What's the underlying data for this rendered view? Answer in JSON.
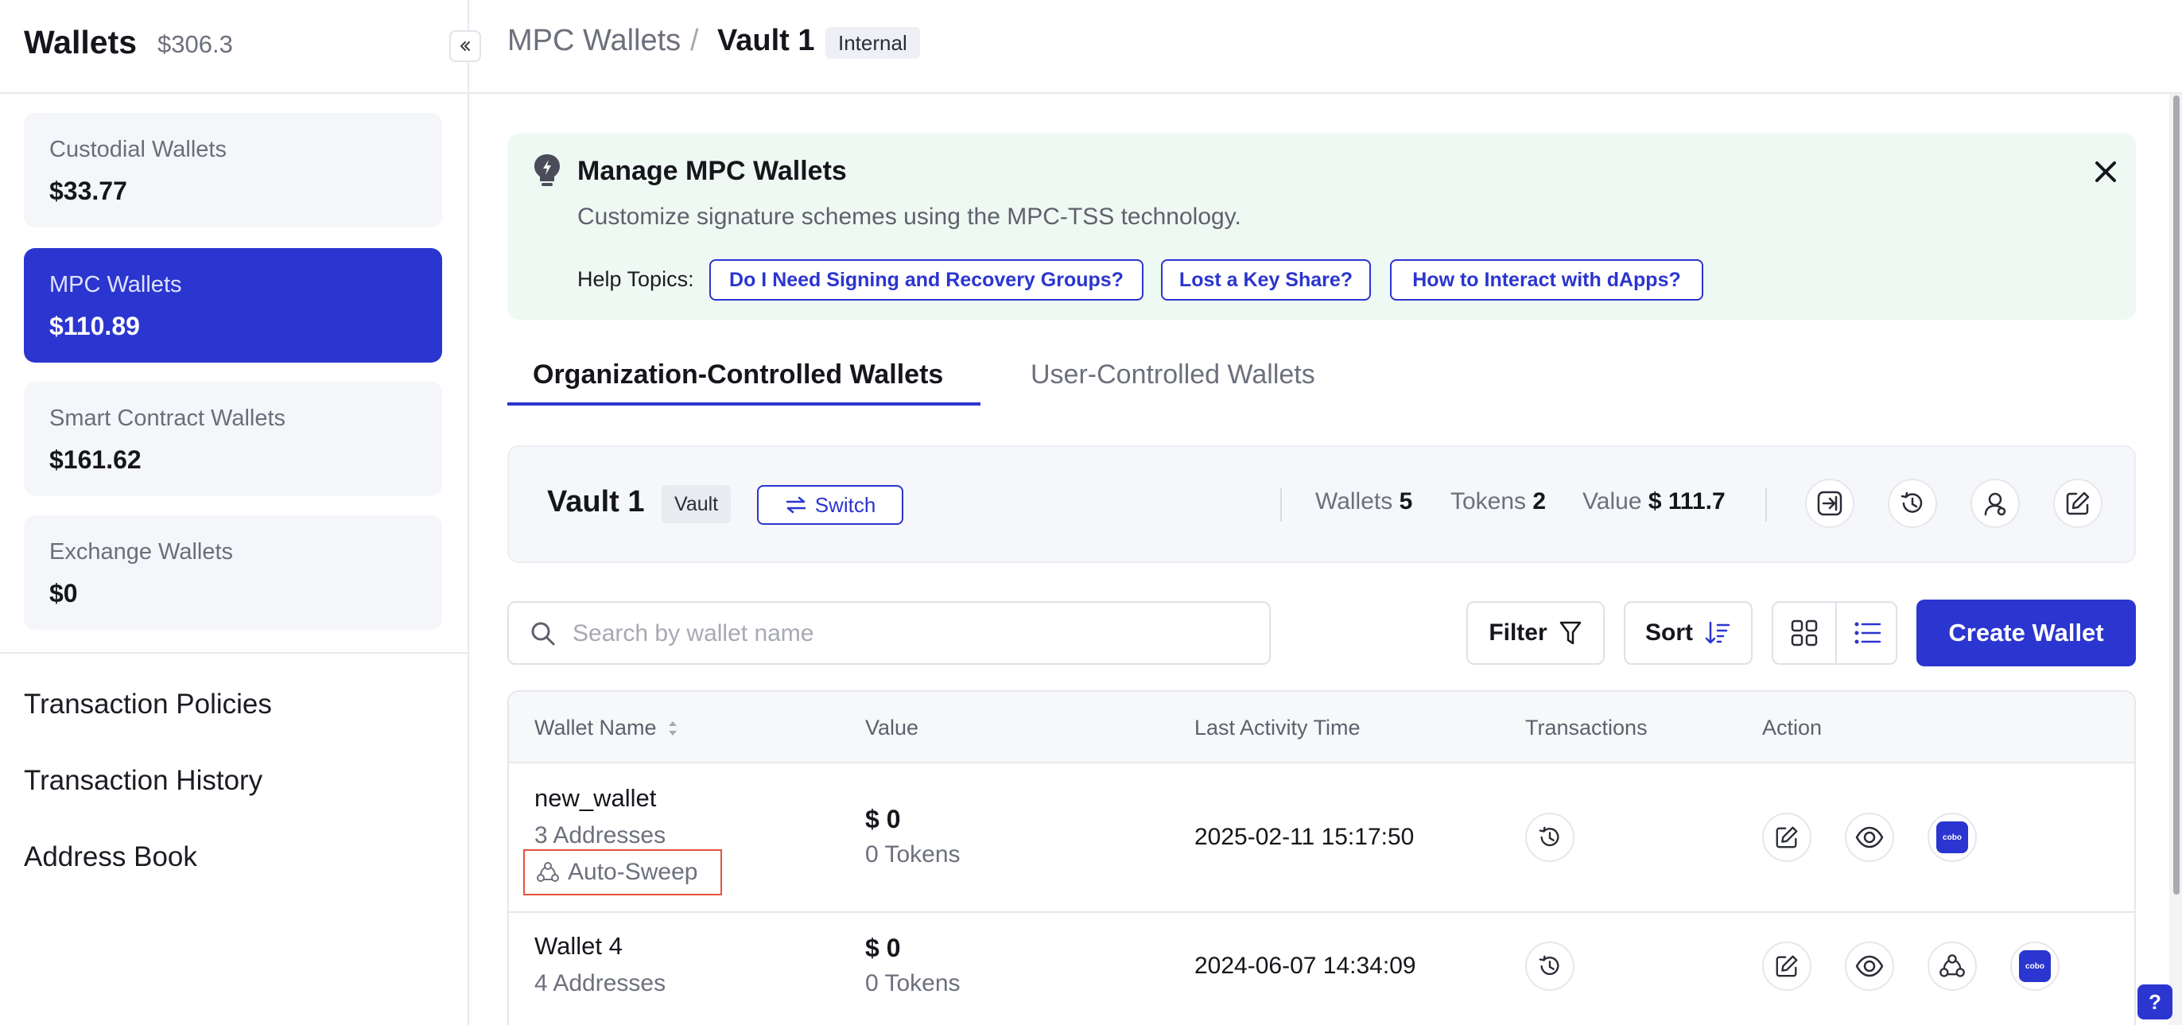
{
  "sidebar": {
    "title": "Wallets",
    "total": "$306.3",
    "wallet_types": [
      {
        "name": "Custodial Wallets",
        "value": "$33.77"
      },
      {
        "name": "MPC Wallets",
        "value": "$110.89"
      },
      {
        "name": "Smart Contract Wallets",
        "value": "$161.62"
      },
      {
        "name": "Exchange Wallets",
        "value": "$0"
      }
    ],
    "links": [
      "Transaction Policies",
      "Transaction History",
      "Address Book"
    ]
  },
  "header": {
    "breadcrumb_parent": "MPC Wallets",
    "separator": "/",
    "breadcrumb_current": "Vault 1",
    "badge": "Internal"
  },
  "banner": {
    "title": "Manage MPC Wallets",
    "description": "Customize signature schemes using the MPC-TSS technology.",
    "help_label": "Help Topics:",
    "help_topics": [
      "Do I Need Signing and Recovery Groups?",
      "Lost a Key Share?",
      "How to Interact with dApps?"
    ]
  },
  "tabs": [
    {
      "label": "Organization-Controlled Wallets",
      "active": true
    },
    {
      "label": "User-Controlled Wallets",
      "active": false
    }
  ],
  "vault": {
    "name": "Vault 1",
    "badge": "Vault",
    "switch_label": "Switch",
    "wallets_label": "Wallets",
    "wallets_count": "5",
    "tokens_label": "Tokens",
    "tokens_count": "2",
    "value_label": "Value",
    "value_amount": "$ 111.7"
  },
  "toolbar": {
    "search_placeholder": "Search by wallet name",
    "filter_label": "Filter",
    "sort_label": "Sort",
    "create_label": "Create Wallet"
  },
  "table": {
    "columns": [
      "Wallet Name",
      "Value",
      "Last Activity Time",
      "Transactions",
      "Action"
    ],
    "rows": [
      {
        "name": "new_wallet",
        "addresses": "3 Addresses",
        "tag": "Auto-Sweep",
        "value": "$ 0",
        "tokens": "0 Tokens",
        "last_activity": "2025-02-11 15:17:50"
      },
      {
        "name": "Wallet 4",
        "addresses": "4 Addresses",
        "value": "$ 0",
        "tokens": "0 Tokens",
        "last_activity": "2024-06-07 14:34:09"
      }
    ]
  },
  "colors": {
    "accent": "#2b35cf",
    "banner_bg": "#eff9f3",
    "highlight_border": "#e5533d"
  }
}
